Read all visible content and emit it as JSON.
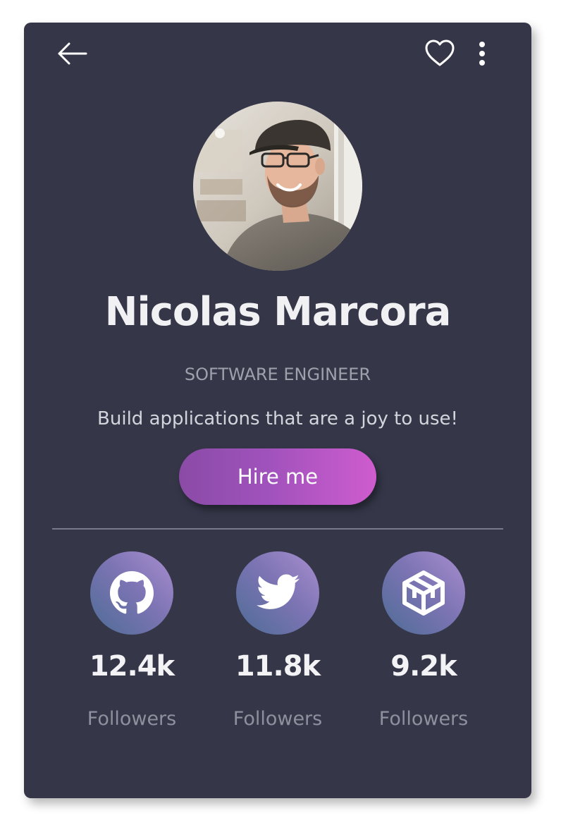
{
  "profile": {
    "name": "Nicolas Marcora",
    "role": "SOFTWARE ENGINEER",
    "tagline": "Build applications that are a joy to use!",
    "hire_label": "Hire me",
    "avatar_icon": "person-photo"
  },
  "header": {
    "back_icon": "arrow-left-icon",
    "favorite_icon": "heart-outline-icon",
    "more_icon": "vertical-ellipsis-icon"
  },
  "stats": [
    {
      "platform_icon": "github-icon",
      "count": "12.4k",
      "label": "Followers"
    },
    {
      "platform_icon": "twitter-icon",
      "count": "11.8k",
      "label": "Followers"
    },
    {
      "platform_icon": "codepen-icon",
      "count": "9.2k",
      "label": "Followers"
    }
  ],
  "colors": {
    "card_background": "#353749",
    "button_gradient_start": "#8a4ba6",
    "button_gradient_end": "#cf5ccf",
    "social_gradient_start": "#a98fd0",
    "social_gradient_end": "#4d6c95"
  }
}
